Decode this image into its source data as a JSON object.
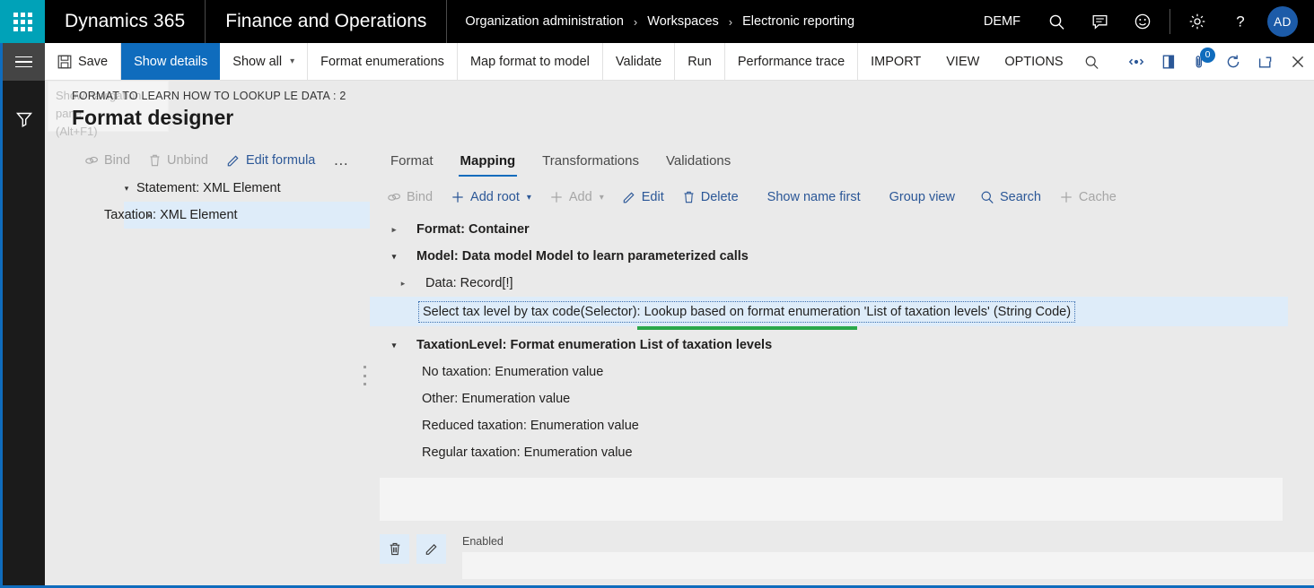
{
  "topbar": {
    "waffle_icon": "app-launcher-grid-icon",
    "brand": "Dynamics 365",
    "module": "Finance and Operations",
    "breadcrumb": [
      "Organization administration",
      "Workspaces",
      "Electronic reporting"
    ],
    "chevron": "›",
    "legal_entity": "DEMF",
    "icons": [
      "search-icon",
      "feedback-icon",
      "smiley-icon",
      "gear-icon",
      "help-icon"
    ],
    "avatar_initials": "AD"
  },
  "rail": {
    "hamburger_icon": "hamburger-menu-icon",
    "filter_icon": "filter-funnel-icon"
  },
  "toolbar": {
    "save": "Save",
    "show_details": "Show details",
    "show_all": "Show all",
    "format_enumerations": "Format enumerations",
    "map_format_to_model": "Map format to model",
    "validate": "Validate",
    "run": "Run",
    "performance_trace": "Performance trace",
    "import": "IMPORT",
    "view": "VIEW",
    "options": "OPTIONS",
    "search_icon": "search-icon",
    "right_icons": [
      "related-information-icon",
      "open-pane-icon",
      "attachments-icon",
      "refresh-icon",
      "popout-icon",
      "close-icon"
    ],
    "attachment_badge": "0"
  },
  "tooltip": {
    "line1": "Show navigation pane",
    "line2": "(Alt+F1)"
  },
  "page": {
    "eyebrow": "FORMAT TO LEARN HOW TO LOOKUP LE DATA : 2",
    "title": "Format designer"
  },
  "left_pane": {
    "actions": [
      {
        "label": "Bind",
        "icon": "bind-link-icon",
        "enabled": false
      },
      {
        "label": "Unbind",
        "icon": "unbind-trash-icon",
        "enabled": false
      },
      {
        "label": "Edit formula",
        "icon": "pencil-icon",
        "enabled": true
      },
      {
        "label": "…",
        "icon": "more-ellipsis-icon",
        "enabled": true
      }
    ],
    "tree": [
      {
        "label": "Statement: XML Element",
        "expanded": true,
        "indent": 0,
        "selected": false
      },
      {
        "label": "Taxation: XML Element",
        "expanded": false,
        "indent": 1,
        "selected": true
      }
    ]
  },
  "right_pane": {
    "tabs": [
      {
        "label": "Format",
        "active": false
      },
      {
        "label": "Mapping",
        "active": true
      },
      {
        "label": "Transformations",
        "active": false
      },
      {
        "label": "Validations",
        "active": false
      }
    ],
    "actions": [
      {
        "label": "Bind",
        "icon": "bind-link-icon",
        "enabled": false,
        "caret": false
      },
      {
        "label": "Add root",
        "icon": "plus-icon",
        "enabled": true,
        "caret": true
      },
      {
        "label": "Add",
        "icon": "plus-icon",
        "enabled": false,
        "caret": true
      },
      {
        "label": "Edit",
        "icon": "pencil-icon",
        "enabled": true,
        "caret": false
      },
      {
        "label": "Delete",
        "icon": "trash-icon",
        "enabled": true,
        "caret": false
      },
      {
        "label": "Show name first",
        "icon": "",
        "enabled": true,
        "caret": false
      },
      {
        "label": "Group view",
        "icon": "",
        "enabled": true,
        "caret": false
      },
      {
        "label": "Search",
        "icon": "search-icon",
        "enabled": true,
        "caret": false
      },
      {
        "label": "Cache",
        "icon": "plus-icon",
        "enabled": false,
        "caret": false
      }
    ],
    "tree": [
      {
        "label": "Format: Container",
        "twisty": "collapsed",
        "indent": 0,
        "bold": true,
        "selected": false
      },
      {
        "label": "Model: Data model Model to learn parameterized calls",
        "twisty": "expanded",
        "indent": 0,
        "bold": true,
        "selected": false
      },
      {
        "label": "Data: Record[!]",
        "twisty": "collapsed",
        "indent": 1,
        "bold": false,
        "selected": false
      },
      {
        "label": "Select tax level by tax code(Selector): Lookup based on format enumeration 'List of taxation levels' (String Code)",
        "twisty": "none",
        "indent": 2,
        "bold": false,
        "selected": true
      },
      {
        "label": "TaxationLevel: Format enumeration List of taxation levels",
        "twisty": "expanded",
        "indent": 0,
        "bold": true,
        "selected": false
      },
      {
        "label": "No taxation: Enumeration value",
        "twisty": "none",
        "indent": 1,
        "bold": false,
        "selected": false
      },
      {
        "label": "Other: Enumeration value",
        "twisty": "none",
        "indent": 1,
        "bold": false,
        "selected": false
      },
      {
        "label": "Reduced taxation: Enumeration value",
        "twisty": "none",
        "indent": 1,
        "bold": false,
        "selected": false
      },
      {
        "label": "Regular taxation: Enumeration value",
        "twisty": "none",
        "indent": 1,
        "bold": false,
        "selected": false
      }
    ]
  },
  "bottom": {
    "delete_icon": "trash-icon",
    "edit_icon": "pencil-icon",
    "field_label": "Enabled",
    "field_value": "",
    "field_placeholder": ""
  },
  "colors": {
    "brand_teal": "#00a2b8",
    "accent_blue": "#0f6cbd",
    "link_blue": "#2b5797",
    "selection_blue": "#deecf9",
    "green_bar": "#2aa84a",
    "topbar_black": "#000000",
    "page_bg": "#eaeaea"
  }
}
